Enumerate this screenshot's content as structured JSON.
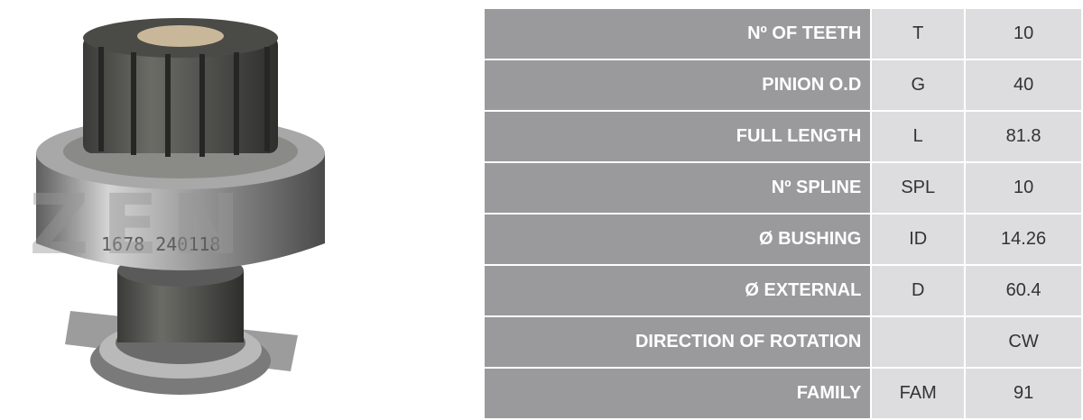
{
  "image": {
    "alt": "Starter drive pinion",
    "watermark_text": "ZEN",
    "stamp_text": "1678 240118"
  },
  "specs": [
    {
      "label": "Nº OF TEETH",
      "code": "T",
      "value": "10"
    },
    {
      "label": "PINION O.D",
      "code": "G",
      "value": "40"
    },
    {
      "label": "FULL LENGTH",
      "code": "L",
      "value": "81.8"
    },
    {
      "label": "Nº SPLINE",
      "code": "SPL",
      "value": "10"
    },
    {
      "label": "Ø BUSHING",
      "code": "ID",
      "value": "14.26"
    },
    {
      "label": "Ø EXTERNAL",
      "code": "D",
      "value": "60.4"
    },
    {
      "label": "DIRECTION OF ROTATION",
      "code": "",
      "value": "CW"
    },
    {
      "label": "FAMILY",
      "code": "FAM",
      "value": "91"
    }
  ],
  "colors": {
    "label_bg": "#9a9a9c",
    "cell_bg": "#dddddf",
    "label_text": "#ffffff",
    "cell_text": "#333333"
  }
}
